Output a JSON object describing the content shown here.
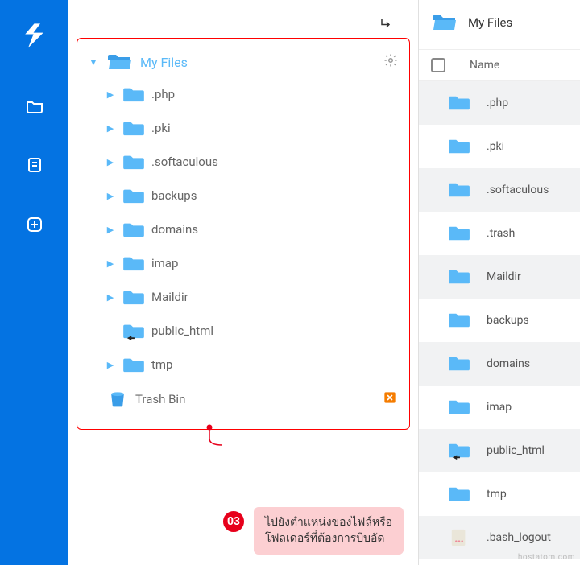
{
  "colors": {
    "brand": "#0473e2",
    "folder": "#5ab9f8",
    "accent_red": "#ff0000",
    "callout_bg": "#fccfd2",
    "badge": "#e7001b"
  },
  "tree": {
    "root": {
      "label": "My Files",
      "icon": "folder-open"
    },
    "children": [
      {
        "label": ".php",
        "expandable": true
      },
      {
        "label": ".pki",
        "expandable": true
      },
      {
        "label": ".softaculous",
        "expandable": true
      },
      {
        "label": "backups",
        "expandable": true
      },
      {
        "label": "domains",
        "expandable": true
      },
      {
        "label": "imap",
        "expandable": true
      },
      {
        "label": "Maildir",
        "expandable": true
      },
      {
        "label": "public_html",
        "expandable": false,
        "symlink": true
      },
      {
        "label": "tmp",
        "expandable": true
      }
    ],
    "trash": {
      "label": "Trash Bin"
    }
  },
  "callout": {
    "number": "03",
    "text_line1": "ไปยังตำแหน่งของไฟล์หรือ",
    "text_line2": "โฟลเดอร์ที่ต้องการบีบอัด"
  },
  "list": {
    "breadcrumb": "My Files",
    "header_name": "Name",
    "rows": [
      {
        "label": ".php",
        "type": "folder",
        "striped": true
      },
      {
        "label": ".pki",
        "type": "folder",
        "striped": false
      },
      {
        "label": ".softaculous",
        "type": "folder",
        "striped": true
      },
      {
        "label": ".trash",
        "type": "folder",
        "striped": false
      },
      {
        "label": "Maildir",
        "type": "folder",
        "striped": true
      },
      {
        "label": "backups",
        "type": "folder",
        "striped": false
      },
      {
        "label": "domains",
        "type": "folder",
        "striped": true
      },
      {
        "label": "imap",
        "type": "folder",
        "striped": false
      },
      {
        "label": "public_html",
        "type": "folder",
        "striped": true,
        "symlink": true
      },
      {
        "label": "tmp",
        "type": "folder",
        "striped": false
      },
      {
        "label": ".bash_logout",
        "type": "file",
        "striped": true
      }
    ]
  },
  "watermark": "hostatom.com"
}
